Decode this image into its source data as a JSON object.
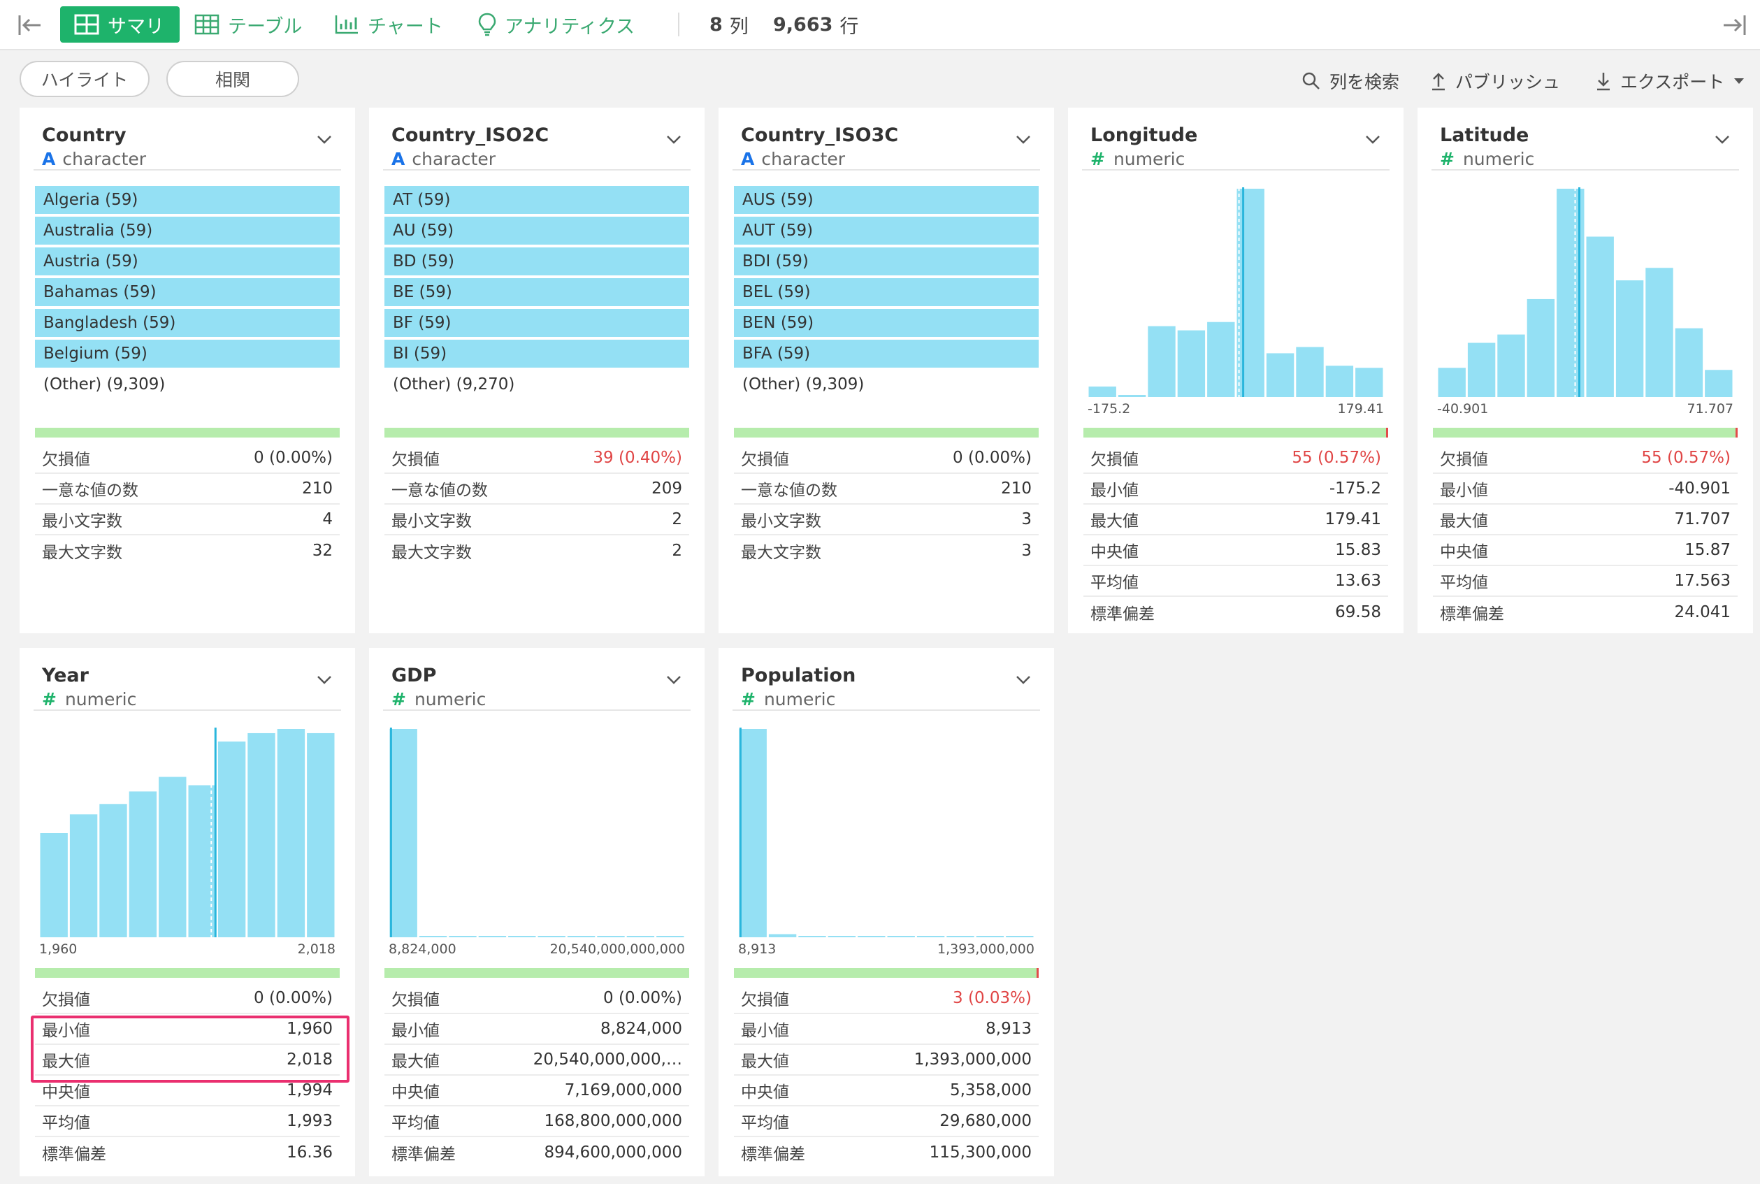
{
  "toolbar": {
    "summary_label": "サマリ",
    "table_label": "テーブル",
    "chart_label": "チャート",
    "analytics_label": "アナリティクス",
    "columns_count": "8",
    "columns_unit": "列",
    "rows_count": "9,663",
    "rows_unit": "行"
  },
  "subbar": {
    "highlight_label": "ハイライト",
    "correlation_label": "相関",
    "search_columns_label": "列を検索",
    "publish_label": "パブリッシュ",
    "export_label": "エクスポート"
  },
  "colors": {
    "accent_green": "#1eb36b",
    "bar_blue": "#94e0f4",
    "median_line": "#29b6dc",
    "quality_green": "#b6ecac",
    "missing_red": "#e04545",
    "highlight_pink": "#ea2f6f"
  },
  "columns": [
    {
      "name": "Country",
      "type": "character",
      "top_values": [
        "Algeria (59)",
        "Australia (59)",
        "Austria (59)",
        "Bahamas (59)",
        "Bangladesh (59)",
        "Belgium (59)"
      ],
      "other": "(Other) (9,309)",
      "stats": [
        {
          "label": "欠損値",
          "value": "0 (0.00%)"
        },
        {
          "label": "一意な値の数",
          "value": "210"
        },
        {
          "label": "最小文字数",
          "value": "4"
        },
        {
          "label": "最大文字数",
          "value": "32"
        }
      ]
    },
    {
      "name": "Country_ISO2C",
      "type": "character",
      "top_values": [
        "AT (59)",
        "AU (59)",
        "BD (59)",
        "BE (59)",
        "BF (59)",
        "BI (59)"
      ],
      "other": "(Other) (9,270)",
      "stats": [
        {
          "label": "欠損値",
          "value": "39 (0.40%)"
        },
        {
          "label": "一意な値の数",
          "value": "209"
        },
        {
          "label": "最小文字数",
          "value": "2"
        },
        {
          "label": "最大文字数",
          "value": "2"
        }
      ]
    },
    {
      "name": "Country_ISO3C",
      "type": "character",
      "top_values": [
        "AUS (59)",
        "AUT (59)",
        "BDI (59)",
        "BEL (59)",
        "BEN (59)",
        "BFA (59)"
      ],
      "other": "(Other) (9,309)",
      "stats": [
        {
          "label": "欠損値",
          "value": "0 (0.00%)"
        },
        {
          "label": "一意な値の数",
          "value": "210"
        },
        {
          "label": "最小文字数",
          "value": "3"
        },
        {
          "label": "最大文字数",
          "value": "3"
        }
      ]
    },
    {
      "name": "Longitude",
      "type": "numeric",
      "axis_min": "-175.2",
      "axis_max": "179.41",
      "hist": [
        0.05,
        0.01,
        0.34,
        0.32,
        0.36,
        1.0,
        0.21,
        0.24,
        0.15,
        0.14
      ],
      "median_bin": 5.25,
      "missing_fraction": 0.0057,
      "stats": [
        {
          "label": "欠損値",
          "value": "55 (0.57%)"
        },
        {
          "label": "最小値",
          "value": "-175.2"
        },
        {
          "label": "最大値",
          "value": "179.41"
        },
        {
          "label": "中央値",
          "value": "15.83"
        },
        {
          "label": "平均値",
          "value": "13.63"
        },
        {
          "label": "標準偏差",
          "value": "69.58"
        }
      ]
    },
    {
      "name": "Latitude",
      "type": "numeric",
      "axis_min": "-40.901",
      "axis_max": "71.707",
      "hist": [
        0.14,
        0.26,
        0.3,
        0.47,
        1.0,
        0.77,
        0.56,
        0.62,
        0.33,
        0.13
      ],
      "median_bin": 4.8,
      "missing_fraction": 0.0057,
      "stats": [
        {
          "label": "欠損値",
          "value": "55 (0.57%)"
        },
        {
          "label": "最小値",
          "value": "-40.901"
        },
        {
          "label": "最大値",
          "value": "71.707"
        },
        {
          "label": "中央値",
          "value": "15.87"
        },
        {
          "label": "平均値",
          "value": "17.563"
        },
        {
          "label": "標準偏差",
          "value": "24.041"
        }
      ]
    },
    {
      "name": "Year",
      "type": "numeric",
      "axis_min": "1,960",
      "axis_max": "2,018",
      "hist": [
        0.5,
        0.59,
        0.64,
        0.7,
        0.77,
        0.73,
        0.94,
        0.98,
        1.0,
        0.98
      ],
      "median_bin": 5.95,
      "missing_fraction": 0,
      "stats": [
        {
          "label": "欠損値",
          "value": "0 (0.00%)"
        },
        {
          "label": "最小値",
          "value": "1,960"
        },
        {
          "label": "最大値",
          "value": "2,018"
        },
        {
          "label": "中央値",
          "value": "1,994"
        },
        {
          "label": "平均値",
          "value": "1,993"
        },
        {
          "label": "標準偏差",
          "value": "16.36"
        }
      ]
    },
    {
      "name": "GDP",
      "type": "numeric",
      "axis_min": "8,824,000",
      "axis_max": "20,540,000,000,000",
      "hist": [
        1.0,
        0.006,
        0.004,
        0.003,
        0.003,
        0.003,
        0.002,
        0.002,
        0.002,
        0.002
      ],
      "median_bin": 0.08,
      "missing_fraction": 0,
      "stats": [
        {
          "label": "欠損値",
          "value": "0 (0.00%)"
        },
        {
          "label": "最小値",
          "value": "8,824,000"
        },
        {
          "label": "最大値",
          "value": "20,540,000,000,…"
        },
        {
          "label": "中央値",
          "value": "7,169,000,000"
        },
        {
          "label": "平均値",
          "value": "168,800,000,000"
        },
        {
          "label": "標準偏差",
          "value": "894,600,000,000"
        }
      ]
    },
    {
      "name": "Population",
      "type": "numeric",
      "axis_min": "8,913",
      "axis_max": "1,393,000,000",
      "hist": [
        1.0,
        0.015,
        0.004,
        0.003,
        0.003,
        0.003,
        0.002,
        0.002,
        0.002,
        0.002
      ],
      "median_bin": 0.08,
      "missing_fraction": 0.0003,
      "stats": [
        {
          "label": "欠損値",
          "value": "3 (0.03%)"
        },
        {
          "label": "最小値",
          "value": "8,913"
        },
        {
          "label": "最大値",
          "value": "1,393,000,000"
        },
        {
          "label": "中央値",
          "value": "5,358,000"
        },
        {
          "label": "平均値",
          "value": "29,680,000"
        },
        {
          "label": "標準偏差",
          "value": "115,300,000"
        }
      ]
    }
  ]
}
